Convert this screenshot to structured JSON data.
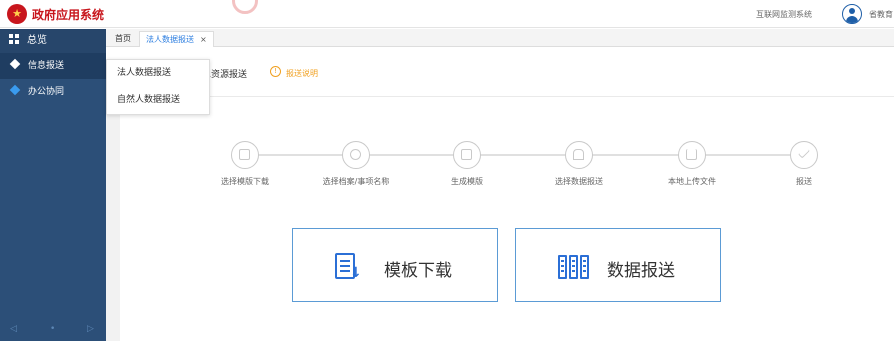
{
  "header": {
    "app_title": "政府应用系统",
    "top_link": "互联网监测系统",
    "user_name": "省教育"
  },
  "sidebar": {
    "heading": "总览",
    "items": [
      {
        "label": "信息报送",
        "icon": "layers-icon"
      },
      {
        "label": "办公协同",
        "icon": "layers-icon"
      }
    ],
    "footer": {
      "prev": "◁",
      "dot": "•",
      "next": "▷"
    }
  },
  "tabs": {
    "home": "首页",
    "active": "法人数据报送",
    "close": "×"
  },
  "sub": {
    "tab_label_fragment": "息资源报送",
    "info_link": "报送说明",
    "info_icon": "!"
  },
  "dropdown": {
    "items": [
      "法人数据报送",
      "自然人数据报送"
    ]
  },
  "steps": [
    {
      "label": "选择模版下载"
    },
    {
      "label": "选择档案/事项名称"
    },
    {
      "label": "生成模版"
    },
    {
      "label": "选择数据报送"
    },
    {
      "label": "本地上传文件"
    },
    {
      "label": "报送"
    }
  ],
  "buttons": {
    "template_download": "模板下载",
    "data_submit": "数据报送"
  },
  "colors": {
    "sidebar_bg": "#2c4f78",
    "accent": "#2b7de0",
    "warning": "#f0a020",
    "brand_red": "#c8161d"
  }
}
